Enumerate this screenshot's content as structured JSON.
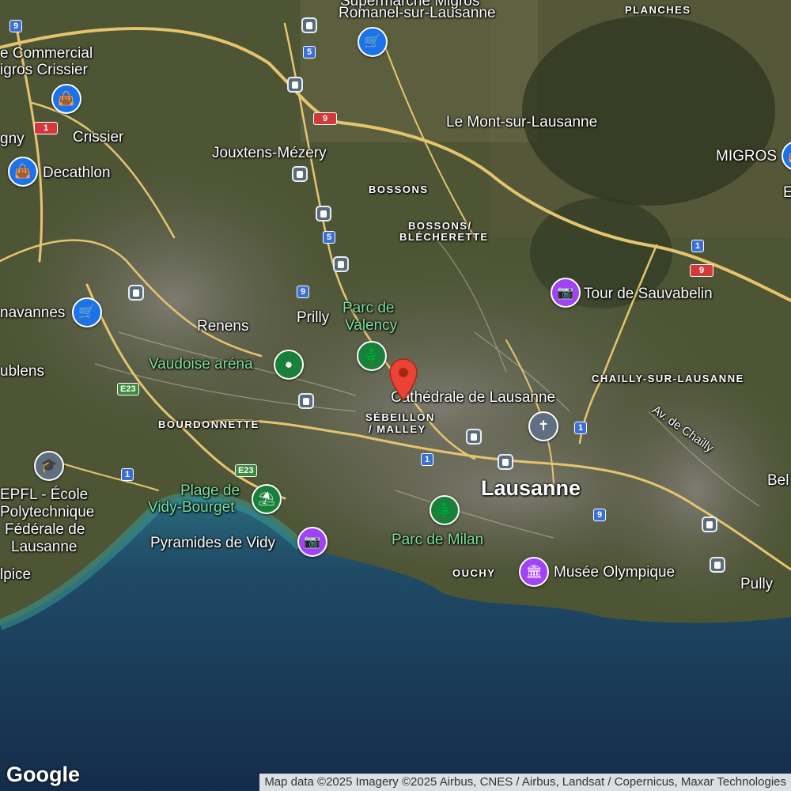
{
  "labels": {
    "romanel": "Romanel-sur-Lausanne",
    "supermarche": "Supermarché Migros",
    "planches": "PLANCHES",
    "centre_commercial": "e Commercial",
    "migros_crissier": "igros Crissier",
    "le_mont": "Le Mont-sur-Lausanne",
    "migros_right": "MIGROS",
    "gny": "gny",
    "crissier": "Crissier",
    "jouxtens": "Jouxtens-Mézery",
    "decathlon": "Decathlon",
    "bossons": "BOSSONS",
    "bossons_blecherette_1": "BOSSONS/",
    "bossons_blecherette_2": "BLÉCHERETTE",
    "e_right": "E",
    "tour_sauvabelin": "Tour de Sauvabelin",
    "chavannes": "navannes",
    "parc_valency_1": "Parc de",
    "parc_valency_2": "Valency",
    "renens": "Renens",
    "prilly": "Prilly",
    "ecublens": "ublens",
    "vaudoise_arena": "Vaudoise aréna",
    "chailly": "CHAILLY-SUR-LAUSANNE",
    "cathedrale": "Cathédrale de Lausanne",
    "av_chailly": "Av. de Chailly",
    "sebeillon_1": "SÉBEILLON",
    "sebeillon_2": "/ MALLEY",
    "bourdonnette": "BOURDONNETTE",
    "epfl_1": "EPFL - École",
    "epfl_2": "Polytechnique",
    "epfl_3": "Fédérale de",
    "epfl_4": "Lausanne",
    "lausanne": "Lausanne",
    "bel": "Bel",
    "plage_vidy_1": "Plage de",
    "plage_vidy_2": "Vidy-Bourget",
    "pyramides": "Pyramides de Vidy",
    "parc_milan": "Parc de Milan",
    "ouchy": "OUCHY",
    "musee_olympique": "Musée Olympique",
    "pully": "Pully",
    "sulpice": "lpice"
  },
  "road_shields": {
    "r9a": "9",
    "r5a": "5",
    "r9b": "9",
    "r1a": "1",
    "r5b": "5",
    "r1b": "1",
    "r9c": "9",
    "r9d": "9",
    "e23a": "E23",
    "e23b": "E23",
    "r1c": "1",
    "r1d": "1",
    "r1e": "1",
    "r9e": "9"
  },
  "google_logo": "Google",
  "attribution": "Map data ©2025 Imagery ©2025 Airbus, CNES / Airbus, Landsat / Copernicus, Maxar Technologies",
  "colors": {
    "lake": "#1f3b5a",
    "land": "#4a5232",
    "road": "#e8c872",
    "pin": "#ea4335"
  }
}
